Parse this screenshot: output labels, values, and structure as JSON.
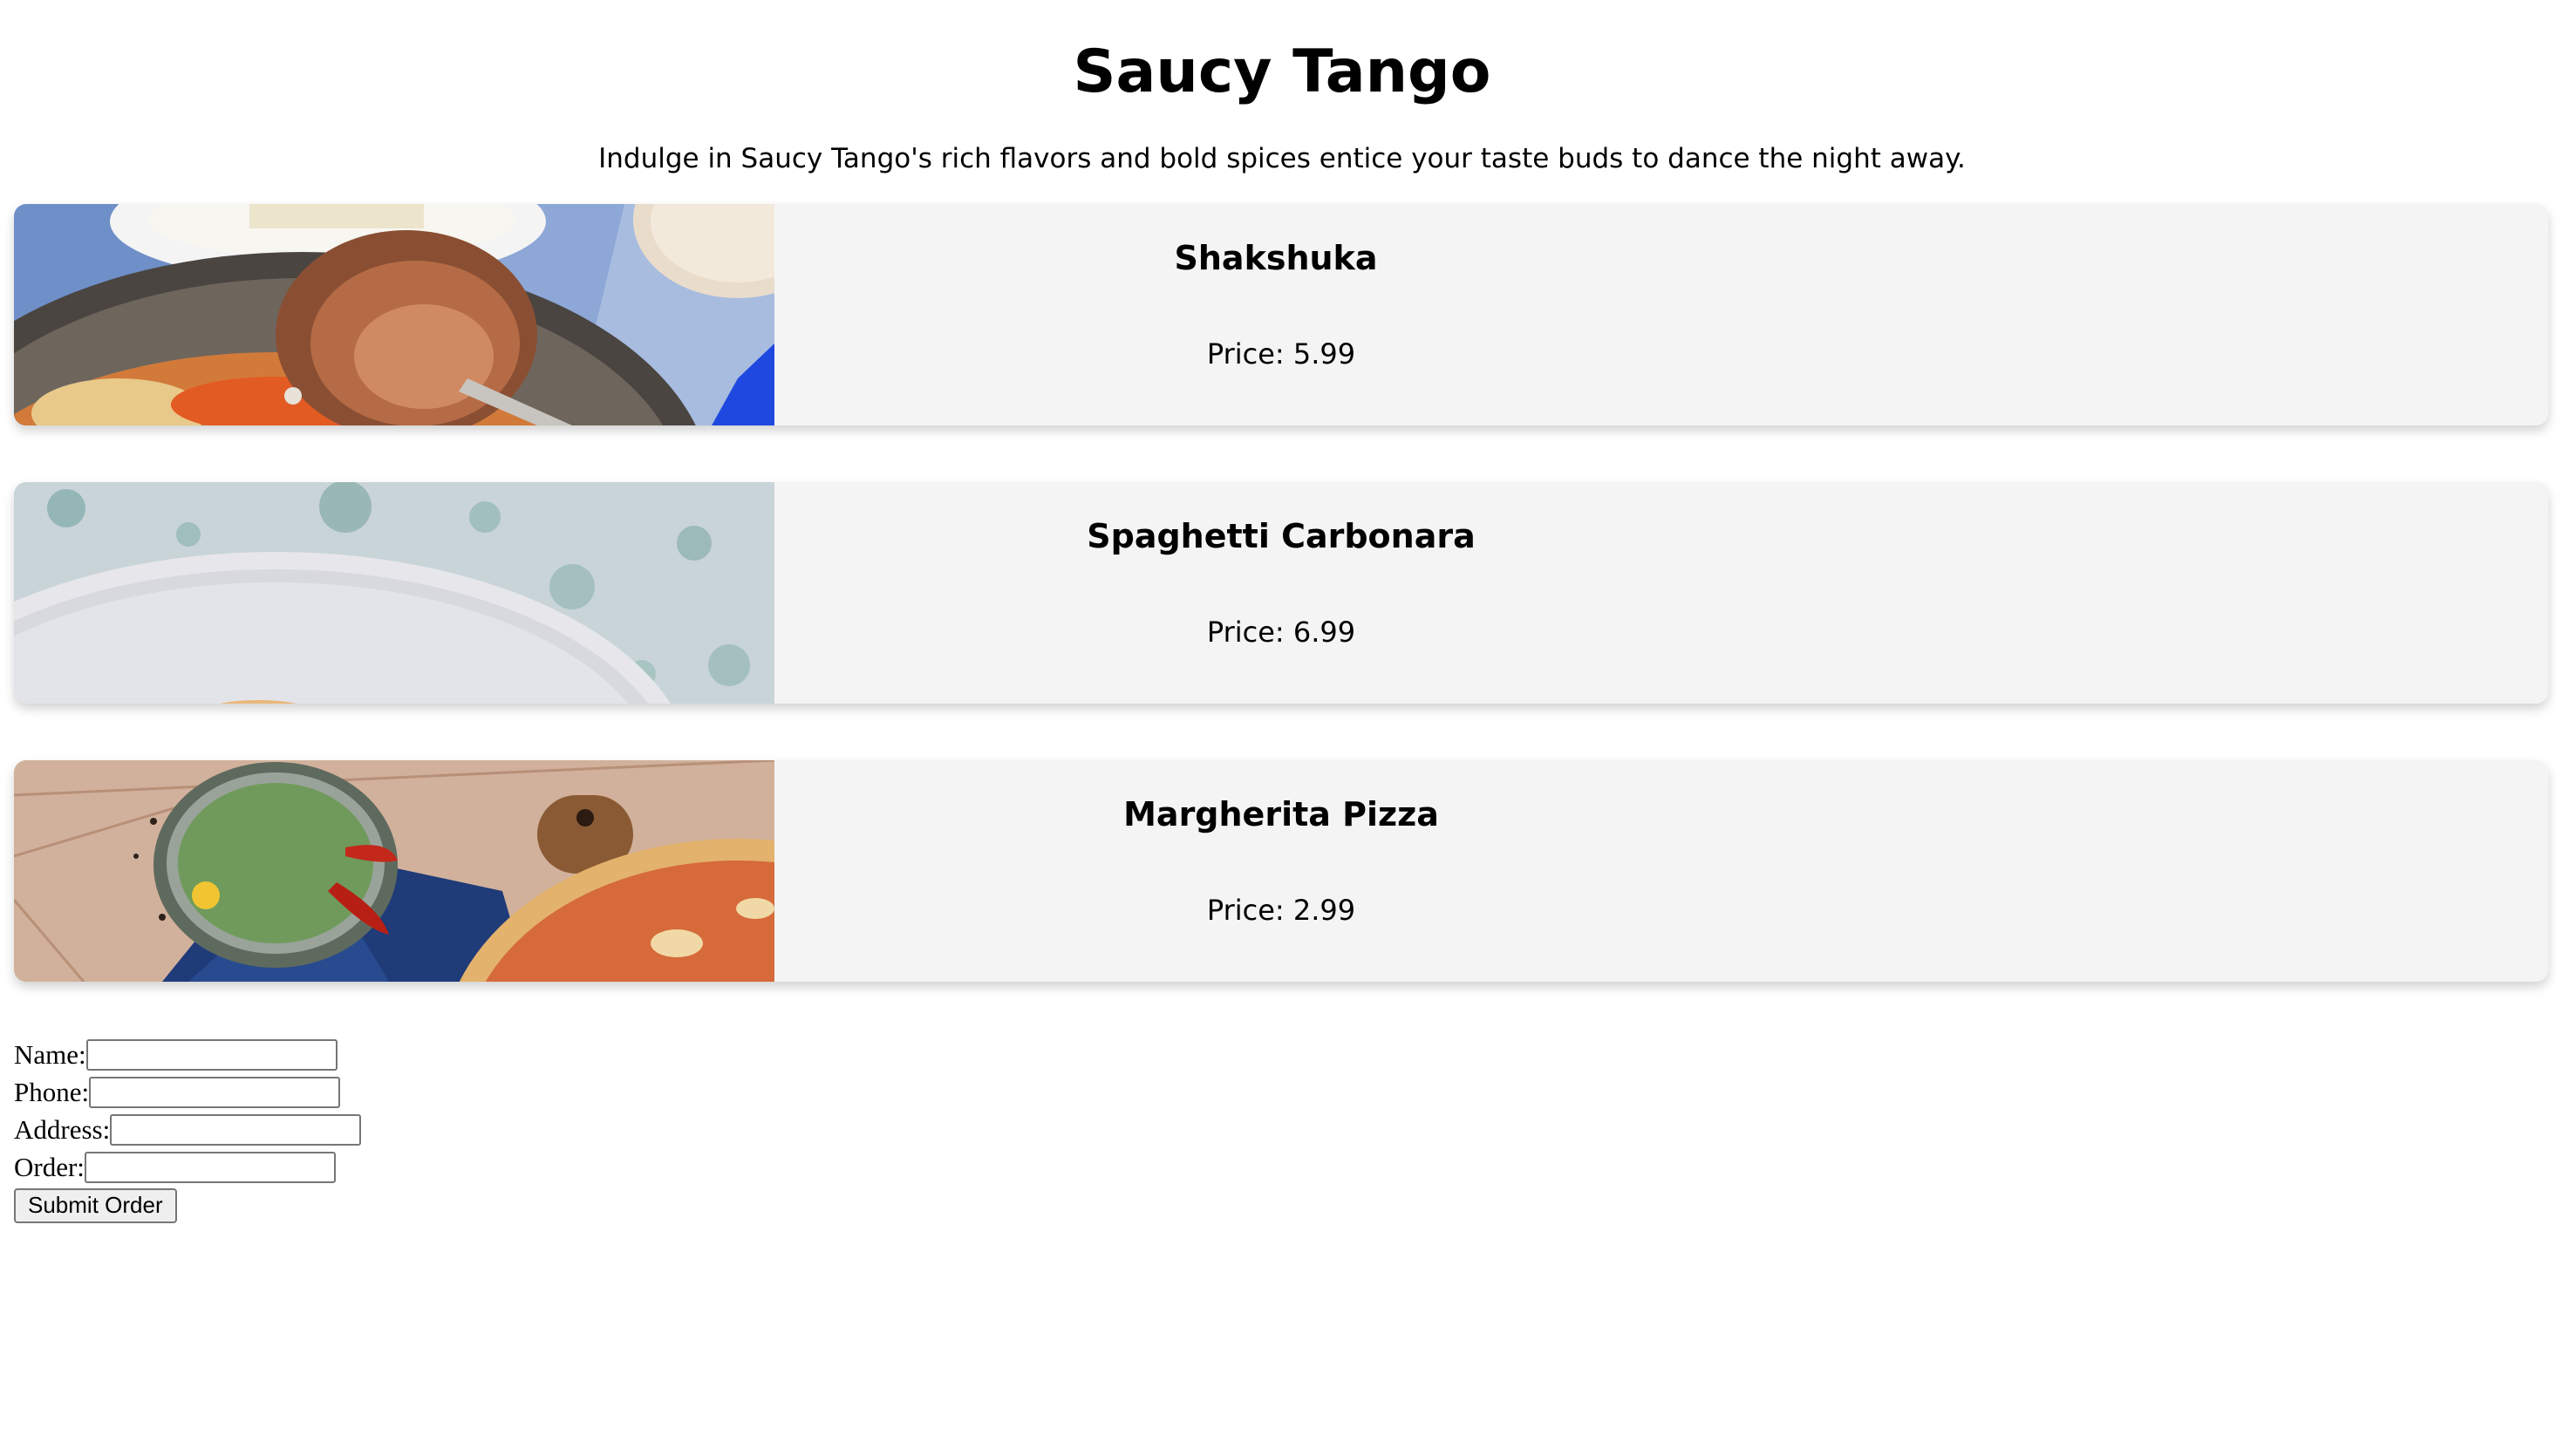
{
  "header": {
    "title": "Saucy Tango",
    "tagline": "Indulge in Saucy Tango's rich flavors and bold spices entice your taste buds to dance the night away."
  },
  "menu": {
    "items": [
      {
        "name": "Shakshuka",
        "price_text": "Price: 5.99",
        "photo_icon": "shakshuka-pan-photo"
      },
      {
        "name": "Spaghetti Carbonara",
        "price_text": "Price: 6.99",
        "photo_icon": "carbonara-plate-photo"
      },
      {
        "name": "Margherita Pizza",
        "price_text": "Price: 2.99",
        "photo_icon": "margherita-pizza-photo"
      }
    ]
  },
  "order_form": {
    "name_label": "Name:",
    "name_value": "",
    "phone_label": "Phone:",
    "phone_value": "",
    "address_label": "Address:",
    "address_value": "",
    "order_label": "Order:",
    "order_value": "",
    "submit_label": "Submit Order"
  },
  "colors": {
    "card_background": "#f4f4f4",
    "page_background": "#ffffff",
    "button_background": "#efefef"
  }
}
